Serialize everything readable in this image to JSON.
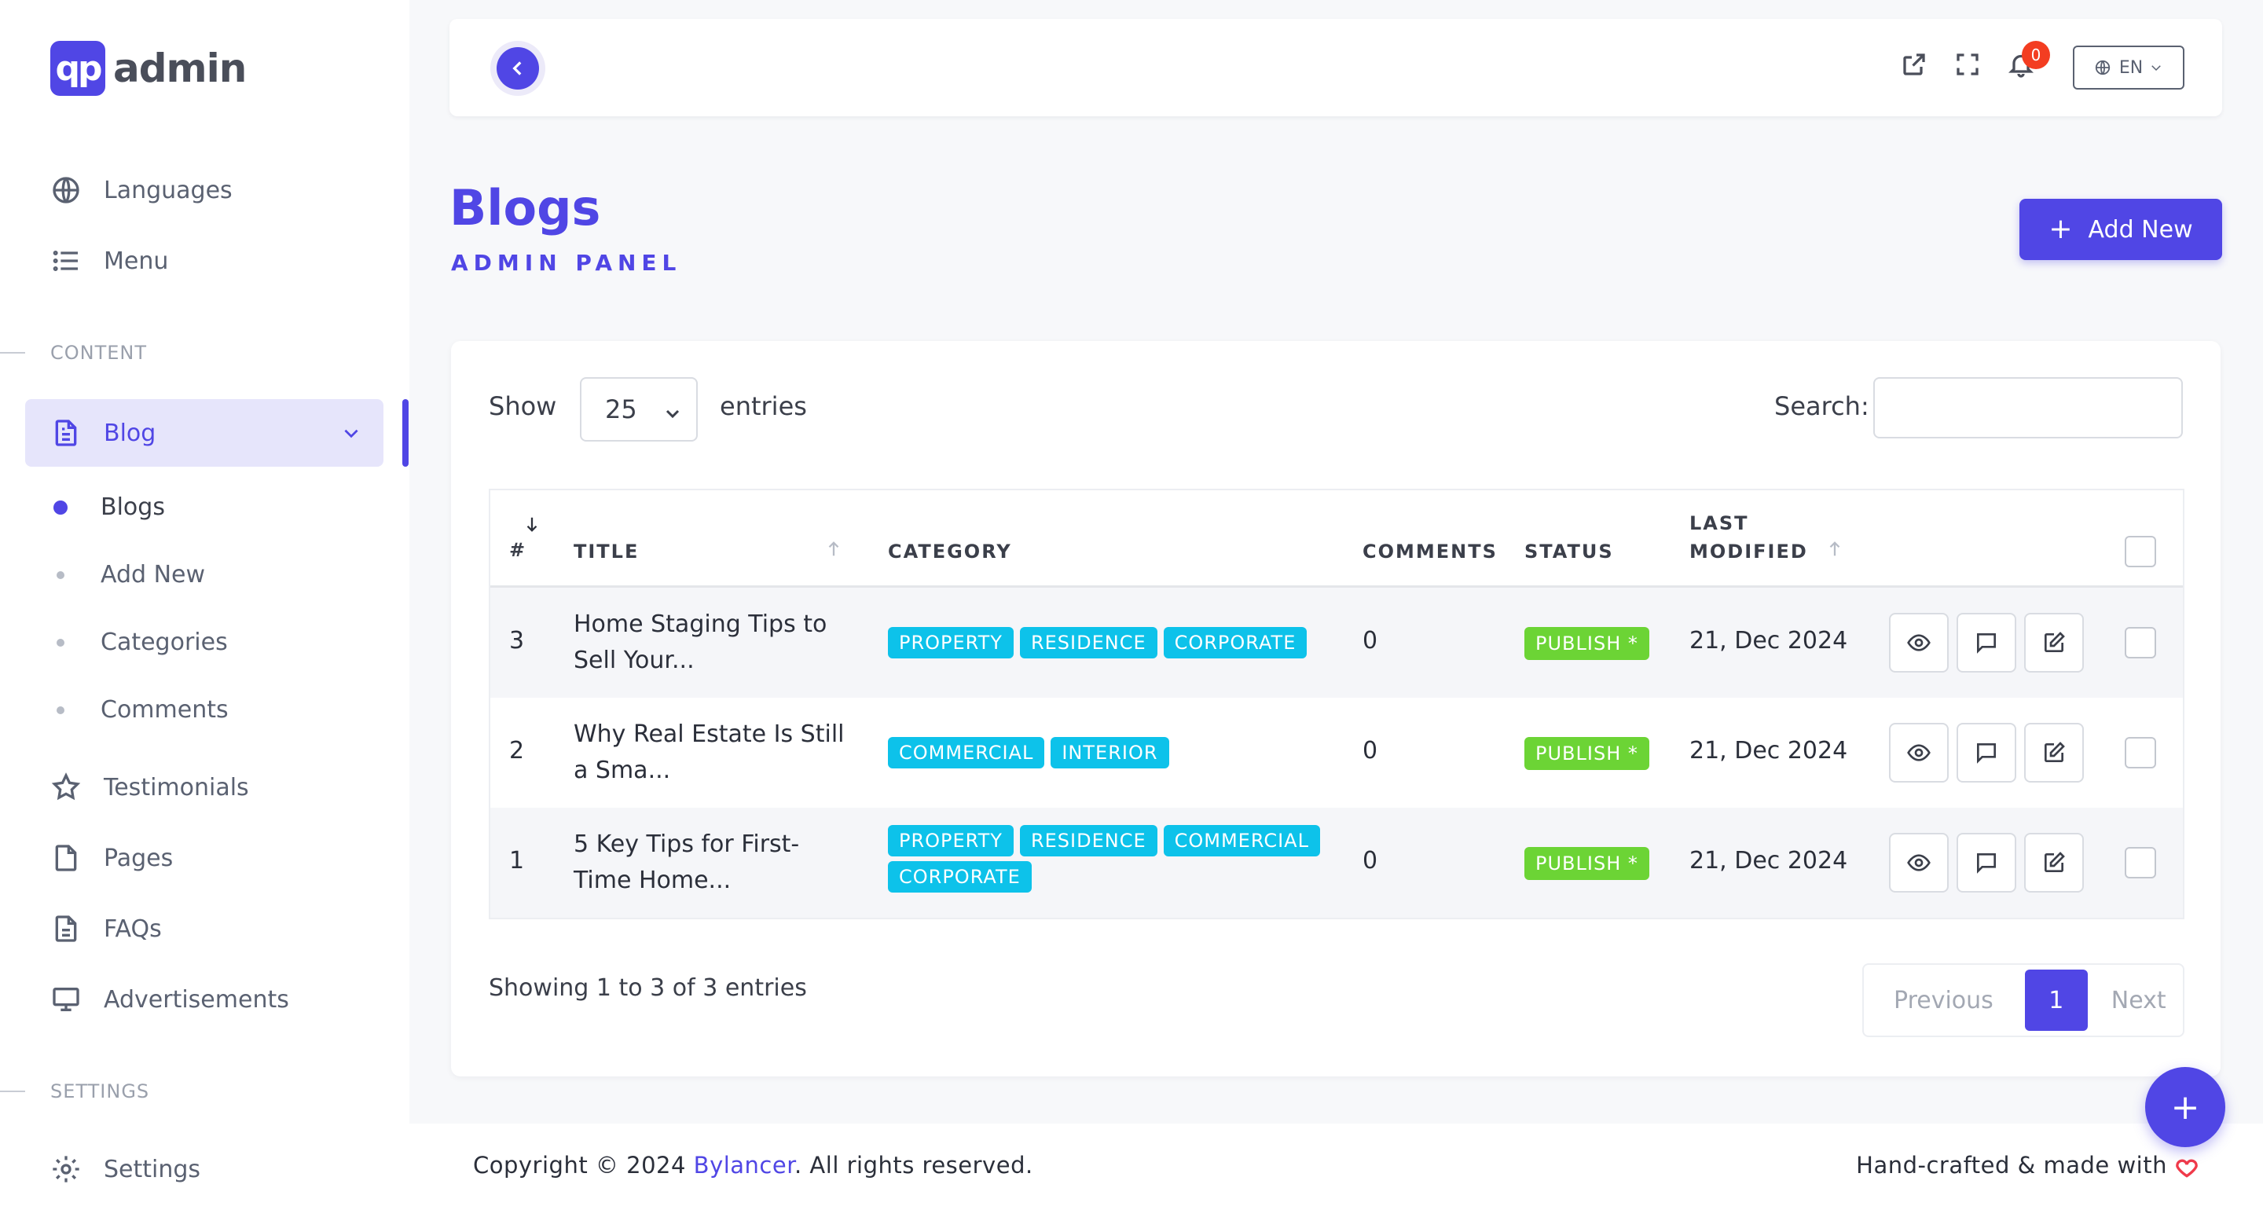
{
  "app": {
    "logo_mark": "qp",
    "logo_text": "admin"
  },
  "sidebar": {
    "top_items": [
      {
        "label": "Languages",
        "icon": "globe-icon"
      },
      {
        "label": "Menu",
        "icon": "list-icon"
      }
    ],
    "section_content": "CONTENT",
    "blog_group": {
      "label": "Blog",
      "icon": "document-icon",
      "children": [
        "Blogs",
        "Add New",
        "Categories",
        "Comments"
      ]
    },
    "content_items": [
      {
        "label": "Testimonials",
        "icon": "star-icon"
      },
      {
        "label": "Pages",
        "icon": "page-icon"
      },
      {
        "label": "FAQs",
        "icon": "faq-document-icon"
      },
      {
        "label": "Advertisements",
        "icon": "monitor-icon"
      }
    ],
    "section_settings": "SETTINGS",
    "settings_items": [
      {
        "label": "Settings",
        "icon": "gear-icon"
      }
    ]
  },
  "topbar": {
    "notification_count": "0",
    "language": "EN"
  },
  "header": {
    "title": "Blogs",
    "subtitle": "ADMIN PANEL",
    "add_new_label": "Add New"
  },
  "table_controls": {
    "show_label": "Show",
    "page_size": "25",
    "entries_label": "entries",
    "search_label": "Search:",
    "search_value": ""
  },
  "table": {
    "columns": [
      "#",
      "TITLE",
      "CATEGORY",
      "COMMENTS",
      "STATUS",
      "LAST",
      "MODIFIED"
    ],
    "rows": [
      {
        "id": "3",
        "title_line1": "Home Staging Tips to",
        "title_line2": "Sell Your...",
        "categories": [
          "PROPERTY",
          "RESIDENCE",
          "CORPORATE"
        ],
        "comments": "0",
        "status": "PUBLISH *",
        "modified": "21, Dec 2024"
      },
      {
        "id": "2",
        "title_line1": "Why Real Estate Is Still",
        "title_line2": "a Sma...",
        "categories": [
          "COMMERCIAL",
          "INTERIOR"
        ],
        "comments": "0",
        "status": "PUBLISH *",
        "modified": "21, Dec 2024"
      },
      {
        "id": "1",
        "title_line1": "5 Key Tips for First-",
        "title_line2": "Time Home...",
        "categories": [
          "PROPERTY",
          "RESIDENCE",
          "COMMERCIAL",
          "CORPORATE"
        ],
        "comments": "0",
        "status": "PUBLISH *",
        "modified": "21, Dec 2024"
      }
    ]
  },
  "pagination": {
    "info": "Showing 1 to 3 of 3 entries",
    "previous": "Previous",
    "current": "1",
    "next": "Next"
  },
  "footer": {
    "copyright_prefix": "Copyright © 2024 ",
    "brand": "Bylancer",
    "copyright_suffix": ". All rights reserved.",
    "made_with": "Hand-crafted & made with"
  },
  "colors": {
    "primary": "#5046e5",
    "category_badge": "#0dc2ea",
    "status_publish": "#6cd435",
    "notification": "#f33d21"
  }
}
